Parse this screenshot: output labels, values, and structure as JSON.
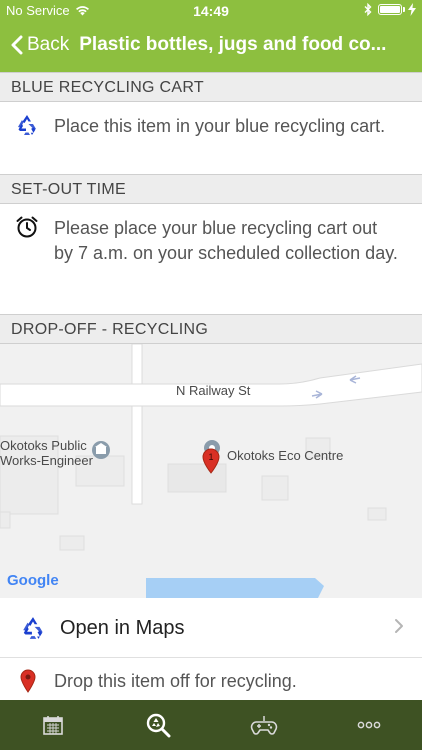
{
  "status_bar": {
    "carrier": "No Service",
    "time": "14:49"
  },
  "nav": {
    "back_label": "Back",
    "title": "Plastic bottles, jugs and food co..."
  },
  "sections": {
    "blue_cart": {
      "header": "BLUE RECYCLING CART",
      "text": "Place this item in your blue recycling cart."
    },
    "set_out": {
      "header": "SET-OUT TIME",
      "text": "Please place your blue recycling cart out by 7 a.m. on your scheduled collection day."
    },
    "drop_off": {
      "header": "DROP-OFF - RECYCLING"
    }
  },
  "map": {
    "street_label": "N Railway St",
    "poi_public_works": "Okotoks Public\nWorks-Engineer",
    "poi_eco_centre": "Okotoks Eco Centre",
    "marker_number": "1",
    "attribution": "Google"
  },
  "actions": {
    "open_in_maps": "Open in Maps",
    "drop_off_text": "Drop this item off for recycling."
  },
  "tabbar": {
    "tabs": [
      {
        "icon": "calendar-icon"
      },
      {
        "icon": "search-recycle-icon"
      },
      {
        "icon": "game-controller-icon"
      },
      {
        "icon": "more-icon"
      }
    ]
  },
  "colors": {
    "brand_green": "#8dbf3f",
    "tabbar_dark": "#3e5223",
    "recycle_blue": "#1a3fcf",
    "marker_red": "#d93025"
  }
}
